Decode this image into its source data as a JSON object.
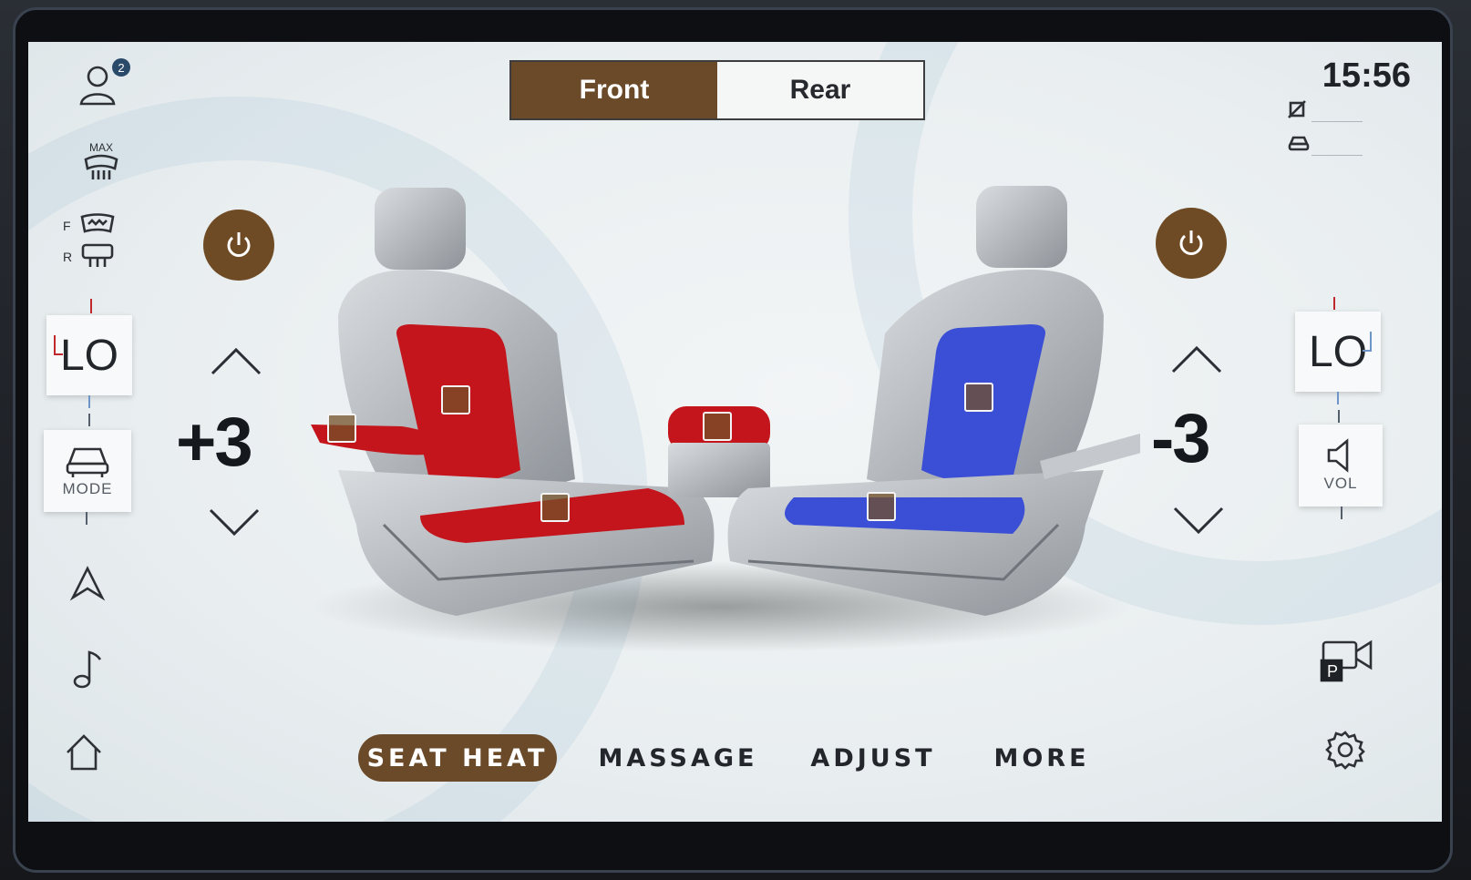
{
  "header": {
    "tabs": [
      {
        "label": "Front",
        "active": true
      },
      {
        "label": "Rear",
        "active": false
      }
    ],
    "time": "15:56",
    "profile_badge": "2"
  },
  "left_rail": {
    "max_label": "MAX",
    "defrost_front_label": "F",
    "defrost_rear_label": "R",
    "fan_value": "LO",
    "mode_label": "MODE",
    "icons": [
      "profile-icon",
      "max-defrost-icon",
      "front-defrost-icon",
      "rear-defrost-icon",
      "navigation-icon",
      "music-icon",
      "home-icon"
    ]
  },
  "right_rail": {
    "fan_value": "LO",
    "vol_label": "VOL",
    "icons": [
      "seatbelt-off-icon",
      "car-status-icon",
      "volume-icon",
      "park-camera-icon",
      "settings-icon"
    ]
  },
  "seats": {
    "left": {
      "level": "+3",
      "mode": "heat",
      "color": "#c4151c"
    },
    "right": {
      "level": "-3",
      "mode": "cool",
      "color": "#3a4fd6"
    }
  },
  "bottom_tabs": [
    {
      "label": "SEAT HEAT",
      "active": true
    },
    {
      "label": "MASSAGE",
      "active": false
    },
    {
      "label": "ADJUST",
      "active": false
    },
    {
      "label": "MORE",
      "active": false
    }
  ],
  "colors": {
    "accent": "#6b4a2a",
    "heat": "#c4151c",
    "cool": "#3a4fd6"
  }
}
